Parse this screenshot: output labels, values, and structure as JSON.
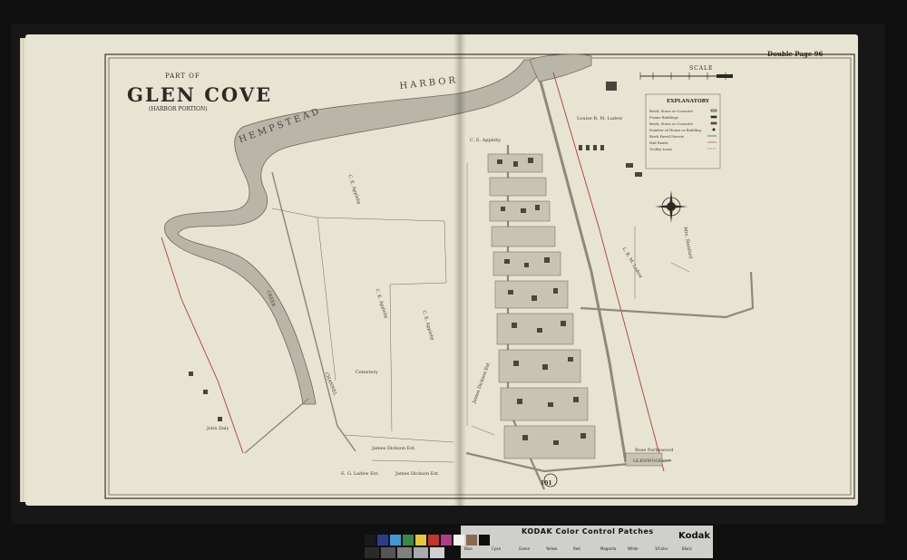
{
  "map": {
    "title_prefix": "PART OF",
    "title": "GLEN COVE",
    "subtitle": "(HARBOR PORTION)",
    "page_label": "Double Page 96",
    "water_label": "HEMPSTEAD HARBOR",
    "water_word_1": "HEMPSTEAD",
    "water_word_2": "HARBOR",
    "creek_label": "CREEK",
    "channel_label": "CHANNEL",
    "route_number": "101",
    "scale_label": "SCALE",
    "legend": {
      "title": "EXPLANATORY",
      "rows": [
        "Brick, Stone or Concrete",
        "Frame Buildings",
        "Brick, Stone or Concrete",
        "Number of House or Building",
        "Brick Paved Streets",
        "Rail Roads",
        "Trolley Lines"
      ]
    },
    "owner_labels": [
      "C. E. Appleby",
      "C. E. Appleby",
      "C. E. Appleby",
      "C. E. Appleby",
      "Louise R. M. Ladew",
      "L. R. M. Ladew",
      "E. G. Ladew Est.",
      "James Dickson Est.",
      "James Dickson Est.",
      "James Dickson Est.",
      "John Daly",
      "Mrs. Stanford",
      "Cemetery",
      "GLENWOOD",
      "Rose Parlinwood"
    ],
    "colors": {
      "paper": "#e8e4d2",
      "water": "#b9b6a8",
      "ink": "#2d2a24",
      "rail_red": "#b23a3a",
      "road": "#9e998a"
    }
  },
  "color_target": {
    "title": "KODAK Color Control Patches",
    "brand": "Kodak",
    "patch_labels": [
      "Blue",
      "Cyan",
      "Green",
      "Yellow",
      "Red",
      "Magenta",
      "White",
      "3/Color",
      "Black"
    ],
    "patch_colors": [
      "#1a1a1a",
      "#2a3d8f",
      "#3f9ad6",
      "#3a8a45",
      "#e8c637",
      "#c0352c",
      "#b13c8a",
      "#f2f2f2",
      "#8a6a4e",
      "#0e0e0e"
    ]
  }
}
